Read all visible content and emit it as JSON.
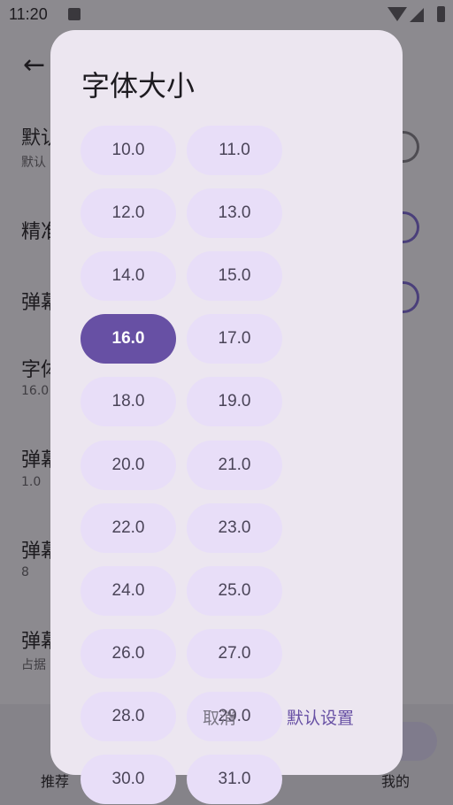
{
  "status_bar": {
    "time": "11:20"
  },
  "background": {
    "back_icon": "arrow-left-icon",
    "items": [
      {
        "title": "默认",
        "subtitle": "默认"
      },
      {
        "title": "精准",
        "subtitle": ""
      },
      {
        "title": "弹幕",
        "subtitle": ""
      },
      {
        "title": "字体",
        "subtitle": "16.0"
      },
      {
        "title": "弹幕",
        "subtitle": "1.0"
      },
      {
        "title": "弹幕",
        "subtitle": "8"
      },
      {
        "title": "弹幕",
        "subtitle": "占据"
      }
    ],
    "bottom_nav": {
      "recommend": "推荐",
      "mine": "我的"
    }
  },
  "dialog": {
    "title": "字体大小",
    "options": [
      "10.0",
      "11.0",
      "12.0",
      "13.0",
      "14.0",
      "15.0",
      "16.0",
      "17.0",
      "18.0",
      "19.0",
      "20.0",
      "21.0",
      "22.0",
      "23.0",
      "24.0",
      "25.0",
      "26.0",
      "27.0",
      "28.0",
      "29.0",
      "30.0",
      "31.0"
    ],
    "selected": "16.0",
    "cancel_label": "取消",
    "default_label": "默认设置"
  },
  "colors": {
    "accent": "#6750a4",
    "chip": "#e8def8",
    "dialog_bg": "#ece6f0"
  }
}
